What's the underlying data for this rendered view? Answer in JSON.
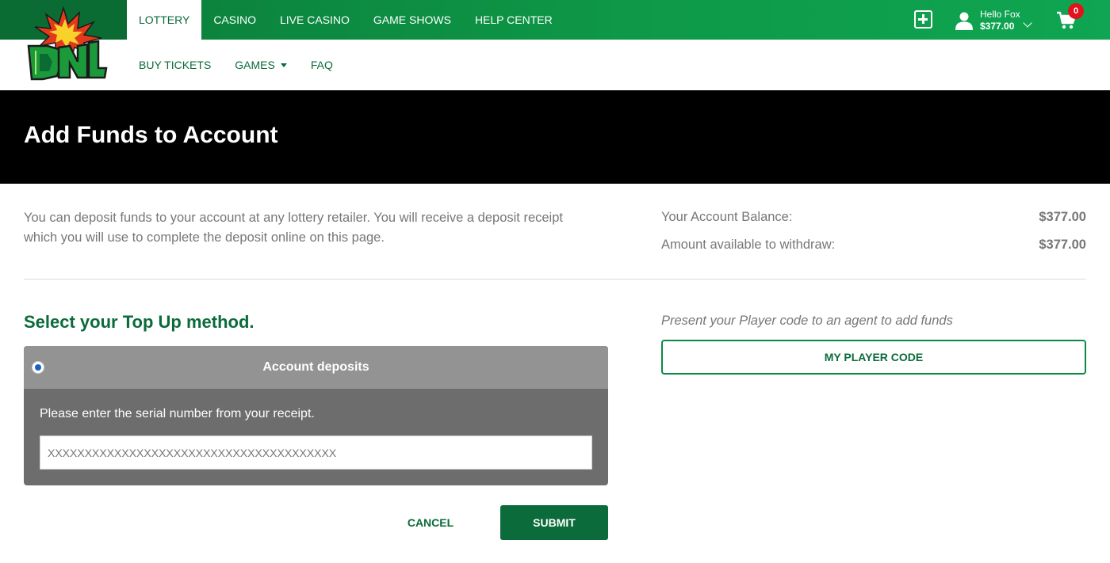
{
  "brand": {
    "logo_text": "DNL",
    "primary_color": "#0b6b3a",
    "accent_color": "#0fa552"
  },
  "header": {
    "top_nav": [
      "LOTTERY",
      "CASINO",
      "LIVE CASINO",
      "GAME SHOWS",
      "HELP CENTER"
    ],
    "active_top_nav": "LOTTERY",
    "sub_nav": {
      "buy_tickets": "BUY TICKETS",
      "games": "GAMES",
      "faq": "FAQ"
    },
    "user": {
      "greeting": "Hello Fox",
      "balance": "$377.00"
    },
    "cart_count": "0",
    "icons": [
      "add-funds-icon",
      "user-icon",
      "chevron-down-icon",
      "cart-icon"
    ]
  },
  "page": {
    "title": "Add Funds to Account"
  },
  "intro": {
    "text": "You can deposit funds to your account at any lottery retailer. You will receive a deposit receipt which you will use to complete the deposit online on this page."
  },
  "balances": {
    "account_label": "Your Account Balance:",
    "account_value": "$377.00",
    "withdraw_label": "Amount available to withdraw:",
    "withdraw_value": "$377.00"
  },
  "topup": {
    "title": "Select your Top Up method.",
    "method_label": "Account deposits",
    "instruction": "Please enter the serial number from your receipt.",
    "serial_placeholder": "XXXXXXXXXXXXXXXXXXXXXXXXXXXXXXXXXXXXXXX",
    "cancel_label": "CANCEL",
    "submit_label": "SUBMIT"
  },
  "player_code": {
    "hint": "Present your Player code to an agent to add funds",
    "button_label": "MY PLAYER CODE"
  }
}
